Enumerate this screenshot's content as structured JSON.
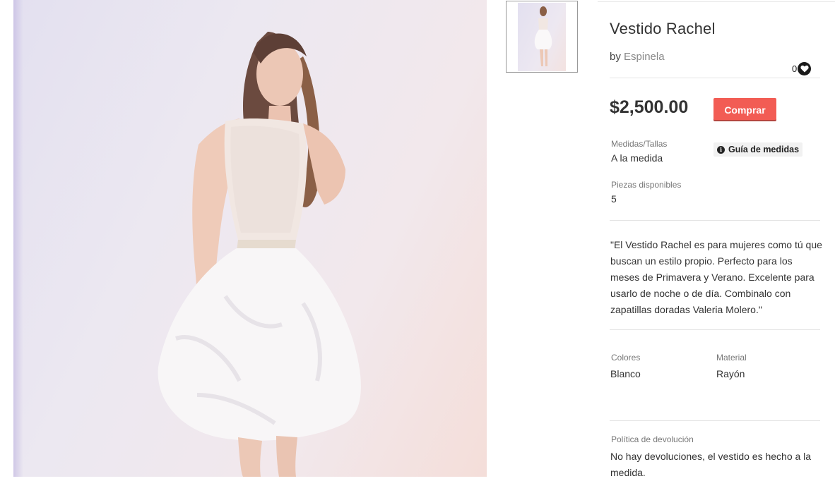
{
  "product": {
    "title": "Vestido Rachel",
    "by_prefix": "by",
    "brand": "Espinela",
    "likes": "0",
    "price": "$2,500.00",
    "buy_label": "Comprar"
  },
  "sizes": {
    "label": "Medidas/Tallas",
    "value": "A la medida",
    "guide_label": "Guía de medidas",
    "guide_icon": "info-icon"
  },
  "stock": {
    "label": "Piezas disponibles",
    "value": "5"
  },
  "description": "\"El Vestido Rachel es para mujeres como tú que buscan un estilo propio. Perfecto para los meses de Primavera y Verano. Excelente para usarlo de noche o de día. Combinalo con zapatillas doradas Valeria Molero.\"",
  "attributes": {
    "colors_label": "Colores",
    "colors_value": "Blanco",
    "material_label": "Material",
    "material_value": "Rayón"
  },
  "returns": {
    "label": "Política de devolución",
    "value": "No hay devoluciones, el vestido es hecho a la medida."
  },
  "colors": {
    "buy_button": "#f25c54",
    "heart_badge": "#1a1a1a"
  }
}
